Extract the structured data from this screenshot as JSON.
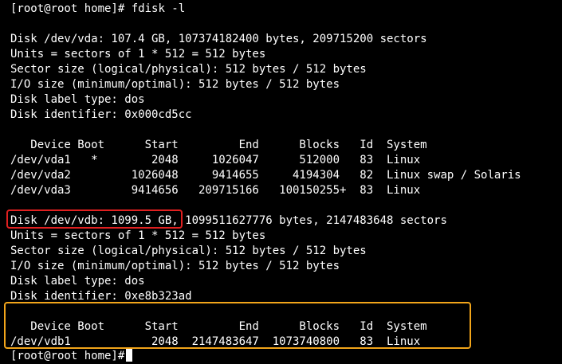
{
  "terminal": {
    "prompt": "[root@root home]#",
    "command": " fdisk -l",
    "vda": {
      "lines": [
        "Disk /dev/vda: 107.4 GB, 107374182400 bytes, 209715200 sectors",
        "Units = sectors of 1 * 512 = 512 bytes",
        "Sector size (logical/physical): 512 bytes / 512 bytes",
        "I/O size (minimum/optimal): 512 bytes / 512 bytes",
        "Disk label type: dos",
        "Disk identifier: 0x000cd5cc"
      ],
      "table_header": "   Device Boot      Start         End      Blocks   Id  System",
      "partitions": [
        "/dev/vda1   *        2048     1026047      512000   83  Linux",
        "/dev/vda2         1026048     9414655     4194304   82  Linux swap / Solaris",
        "/dev/vda3         9414656   209715166   100150255+  83  Linux"
      ]
    },
    "vdb": {
      "lines": [
        "Disk /dev/vdb: 1099.5 GB, 1099511627776 bytes, 2147483648 sectors",
        "Units = sectors of 1 * 512 = 512 bytes",
        "Sector size (logical/physical): 512 bytes / 512 bytes",
        "I/O size (minimum/optimal): 512 bytes / 512 bytes",
        "Disk label type: dos",
        "Disk identifier: 0xe8b323ad"
      ],
      "table_header": "   Device Boot      Start         End      Blocks   Id  System",
      "partitions": [
        "/dev/vdb1            2048  2147483647  1073740800   83  Linux"
      ]
    },
    "final_prompt": "[root@root home]#"
  },
  "highlights": {
    "red_color": "#e02020",
    "yellow_color": "#f2a51a"
  }
}
